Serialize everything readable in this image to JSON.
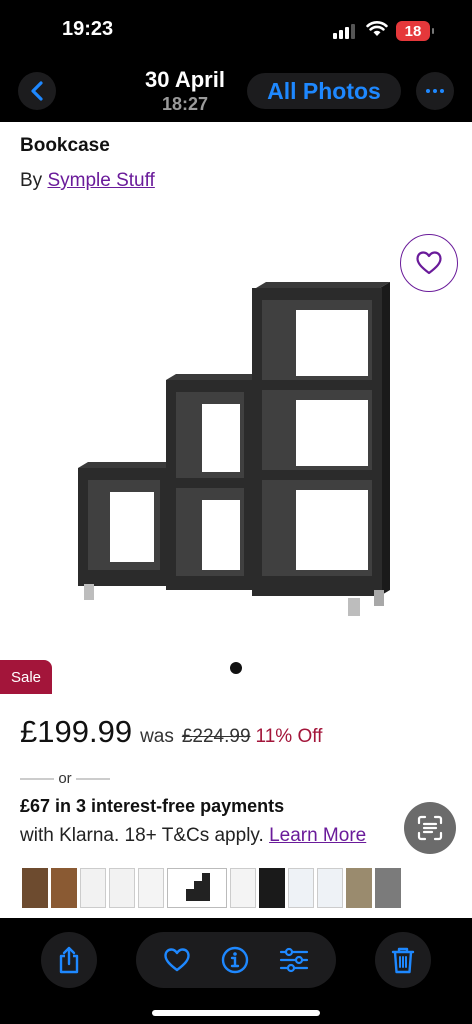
{
  "status_bar": {
    "time": "19:23",
    "battery": "18"
  },
  "photo_header": {
    "date": "30 April",
    "time": "18:27",
    "all_photos_label": "All Photos"
  },
  "product": {
    "title": "Bookcase",
    "by_prefix": "By",
    "brand": "Symple Stuff",
    "sale_badge": "Sale",
    "price": "£199.99",
    "was_label": "was",
    "was_price": "£224.99",
    "discount": "11% Off"
  },
  "klarna": {
    "or_label": "or",
    "main": "£67 in 3 interest-free payments",
    "sub": "with Klarna. 18+ T&Cs apply.",
    "learn_more": "Learn More"
  },
  "colors": {
    "accent": "#1e88ff",
    "brand": "#6a1b9a",
    "sale": "#a3153a",
    "battery": "#e5383b"
  },
  "icons": [
    "back-chevron-icon",
    "more-icon",
    "heart-icon",
    "visual-lookup-icon",
    "share-icon",
    "favorite-icon",
    "info-icon",
    "adjust-icon",
    "trash-icon"
  ]
}
